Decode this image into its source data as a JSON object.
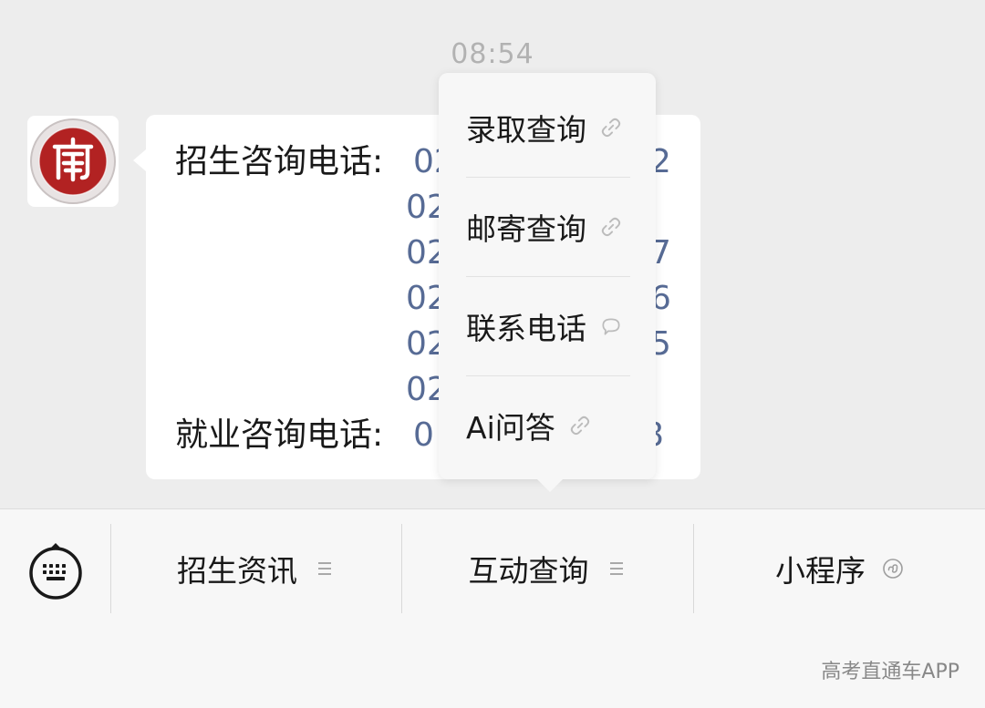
{
  "chat": {
    "timestamp": "08:54",
    "message": {
      "admission_label": "招生咨询电话:",
      "employment_label": "就业咨询电话:",
      "phone_lines": [
        {
          "left": "02",
          "right": "2"
        },
        {
          "left": "02",
          "right": ""
        },
        {
          "left": "02",
          "right": "7"
        },
        {
          "left": "02",
          "right": "6"
        },
        {
          "left": "02",
          "right": "5"
        },
        {
          "left": "02",
          "right": ""
        }
      ],
      "employment_phone": {
        "left": "0",
        "right": "8"
      }
    }
  },
  "popup_menu": {
    "items": [
      {
        "label": "录取查询",
        "icon": "link-icon"
      },
      {
        "label": "邮寄查询",
        "icon": "link-icon"
      },
      {
        "label": "联系电话",
        "icon": "chat-bubble-icon"
      },
      {
        "label": "Ai问答",
        "icon": "link-icon"
      }
    ]
  },
  "bottom_menu": {
    "keyboard_icon": "keyboard-icon",
    "tabs": [
      {
        "label": "招生资讯",
        "icon": "list-icon"
      },
      {
        "label": "互动查询",
        "icon": "list-icon"
      },
      {
        "label": "小程序",
        "icon": "mini-program-icon"
      }
    ]
  },
  "watermark": "高考直通车APP",
  "colors": {
    "background": "#ededed",
    "bubble": "#ffffff",
    "link_blue": "#576b95",
    "logo_red": "#b22222",
    "text": "#191919"
  }
}
